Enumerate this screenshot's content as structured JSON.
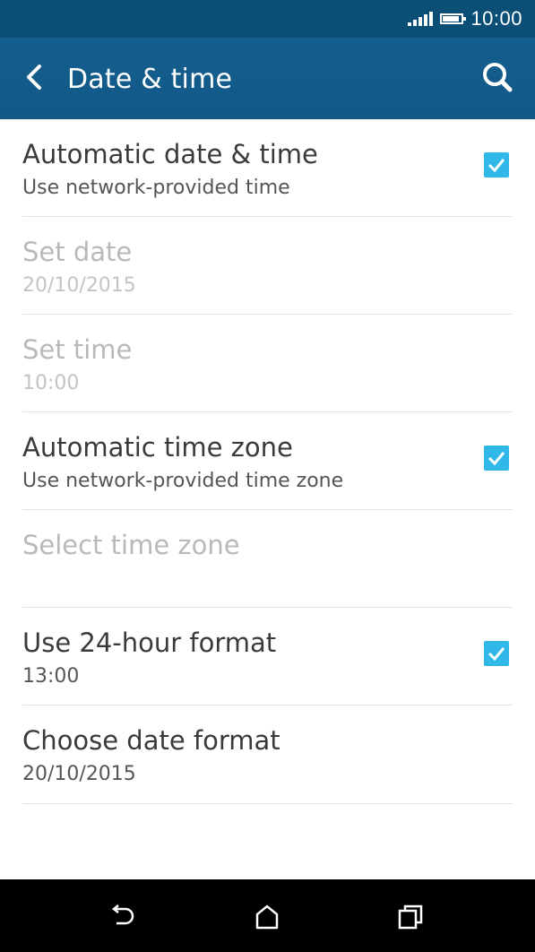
{
  "status_bar": {
    "time": "10:00"
  },
  "app_bar": {
    "title": "Date & time"
  },
  "settings": [
    {
      "title": "Automatic date & time",
      "subtitle": "Use network-provided time"
    },
    {
      "title": "Set date",
      "subtitle": "20/10/2015"
    },
    {
      "title": "Set time",
      "subtitle": "10:00"
    },
    {
      "title": "Automatic time zone",
      "subtitle": "Use network-provided time zone"
    },
    {
      "title": "Select time zone"
    },
    {
      "title": "Use 24-hour format",
      "subtitle": "13:00"
    },
    {
      "title": "Choose date format",
      "subtitle": "20/10/2015"
    }
  ],
  "colors": {
    "status_bar": "#0b4f77",
    "app_bar": "#145f8f",
    "checkbox": "#2fb8e8"
  },
  "icons": {
    "back": "chevron-left-icon",
    "search": "search-icon",
    "nav_back": "back-arrow-icon",
    "home": "home-icon",
    "recents": "recents-icon"
  }
}
